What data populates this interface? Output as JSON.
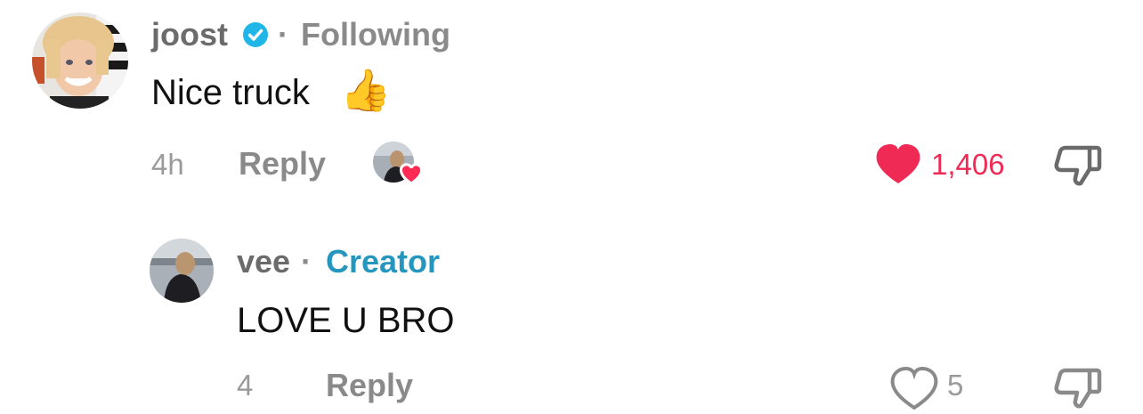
{
  "comments": [
    {
      "username": "joost",
      "verified": true,
      "separator": "·",
      "relation": "Following",
      "text": "Nice truck",
      "emoji": "👍",
      "time": "4h",
      "reply_label": "Reply",
      "liked_by_creator": true,
      "liked": true,
      "likes": "1,406"
    }
  ],
  "replies": [
    {
      "username": "vee",
      "separator": "·",
      "badge": "Creator",
      "text": "LOVE U BRO",
      "time": "4",
      "reply_label": "Reply",
      "likes": "5"
    }
  ],
  "colors": {
    "like_active": "#ee2a55",
    "creator_badge": "#2596be",
    "verified_badge": "#20b6e8",
    "muted_text": "#8a8a8a"
  },
  "icons": {
    "verified": "verified-check-icon",
    "heart": "heart-icon",
    "dislike": "thumbs-down-icon",
    "creator_like": "creator-liked-avatar-icon"
  }
}
